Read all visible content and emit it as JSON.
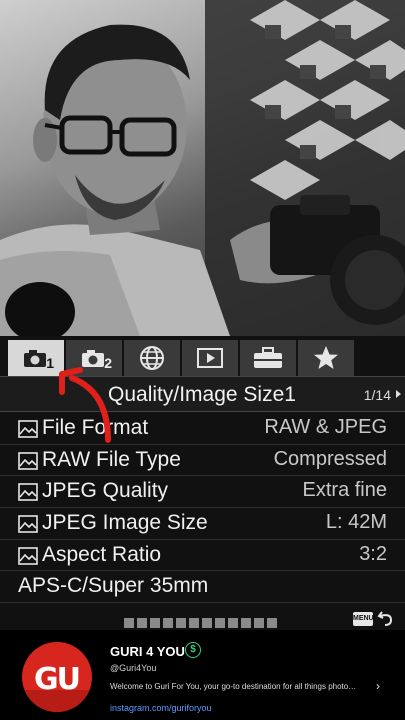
{
  "menu": {
    "tabs": [
      {
        "icon": "camera-icon",
        "num": "1",
        "active": true
      },
      {
        "icon": "camera-icon",
        "num": "2",
        "active": false
      },
      {
        "icon": "globe-icon",
        "num": "",
        "active": false
      },
      {
        "icon": "playback-icon",
        "num": "",
        "active": false
      },
      {
        "icon": "toolbox-icon",
        "num": "",
        "active": false
      },
      {
        "icon": "star-icon",
        "num": "",
        "active": false
      }
    ],
    "title": "Quality/Image Size1",
    "page": "1/14",
    "rows": [
      {
        "label": "File Format",
        "value": "RAW & JPEG",
        "icon": true
      },
      {
        "label": "RAW File Type",
        "value": "Compressed",
        "icon": true
      },
      {
        "label": "JPEG Quality",
        "value": "Extra fine",
        "icon": true
      },
      {
        "label": "JPEG Image Size",
        "value": "L: 42M",
        "icon": true
      },
      {
        "label": "Aspect Ratio",
        "value": "3:2",
        "icon": true
      },
      {
        "label": "APS-C/Super 35mm",
        "value": "",
        "icon": false
      }
    ],
    "menu_button": "MENU",
    "pager_count": 12
  },
  "channel": {
    "name": "GURI 4 YOU",
    "badge": "$",
    "handle": "@Guri4You",
    "description": "Welcome to Guri For You, your go-to destination for all things photograph...",
    "link": "instagram.com/guriforyou",
    "avatar_text": "GU",
    "avatar_color": "#d7261e"
  },
  "colors": {
    "annotation_arrow": "#e0201a",
    "active_tab": "#d8d8d8"
  }
}
